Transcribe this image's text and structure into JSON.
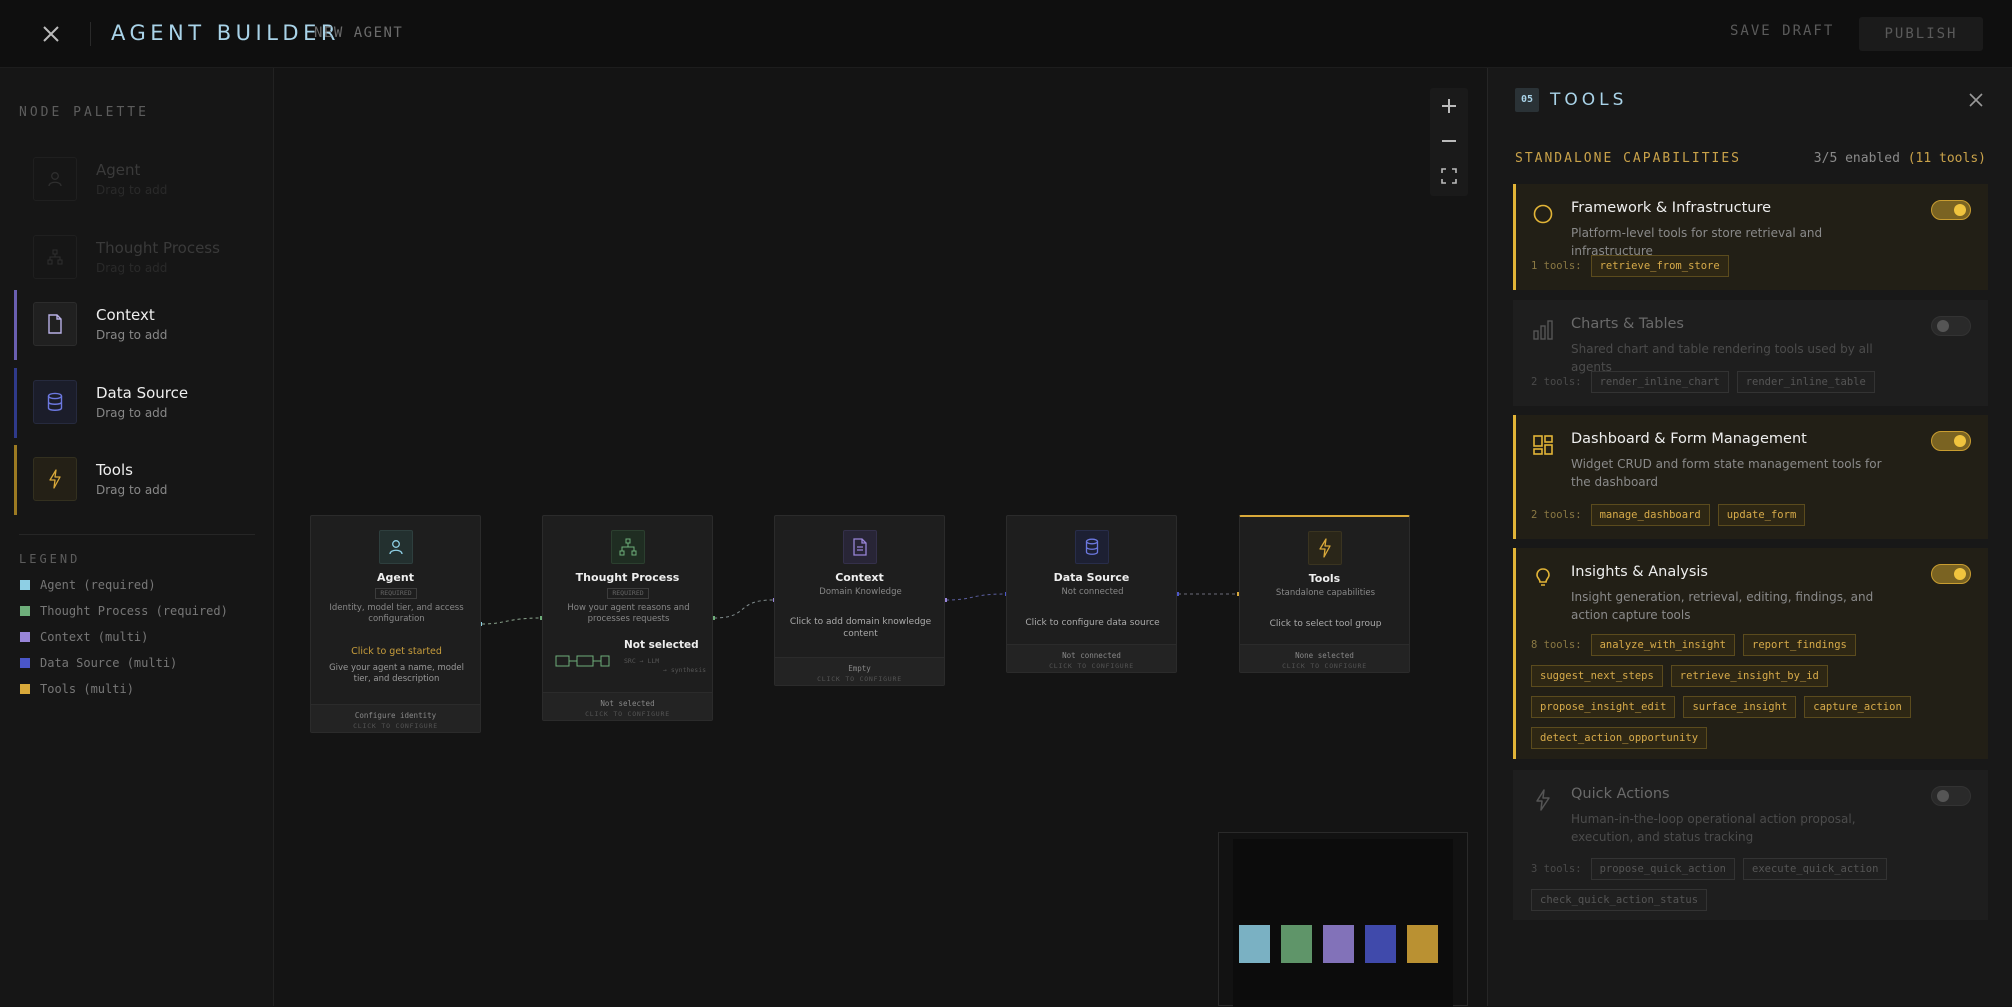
{
  "header": {
    "title": "AGENT BUILDER",
    "agent_name": "NEW AGENT",
    "save_draft": "SAVE DRAFT",
    "publish": "PUBLISH"
  },
  "palette": {
    "title": "NODE PALETTE",
    "items": [
      {
        "label": "Agent",
        "sub": "Drag to add",
        "icon": "user-icon",
        "state": "disabled"
      },
      {
        "label": "Thought Process",
        "sub": "Drag to add",
        "icon": "flow-icon",
        "state": "disabled"
      },
      {
        "label": "Context",
        "sub": "Drag to add",
        "icon": "document-icon",
        "state": "enabled"
      },
      {
        "label": "Data Source",
        "sub": "Drag to add",
        "icon": "database-icon",
        "state": "enabled"
      },
      {
        "label": "Tools",
        "sub": "Drag to add",
        "icon": "lightning-icon",
        "state": "enabled"
      }
    ],
    "legend_title": "LEGEND",
    "legend": [
      {
        "label": "Agent (required)",
        "color": "#8ecfe4"
      },
      {
        "label": "Thought Process (required)",
        "color": "#6eae7a"
      },
      {
        "label": "Context (multi)",
        "color": "#9885d8"
      },
      {
        "label": "Data Source (multi)",
        "color": "#4a56c8"
      },
      {
        "label": "Tools (multi)",
        "color": "#d9a93a"
      }
    ]
  },
  "nodes": {
    "agent": {
      "title": "Agent",
      "badge": "REQUIRED",
      "sub": "Identity, model tier, and access configuration",
      "cta": "Click to get started",
      "cta_sub": "Give your agent a name, model tier, and description",
      "foot": "Configure identity",
      "foot2": "CLICK TO CONFIGURE"
    },
    "thought": {
      "title": "Thought Process",
      "badge": "REQUIRED",
      "sub": "How your agent reasons and processes requests",
      "state": "Not selected",
      "meta1": "SRC → LLM",
      "meta2": "→ synthesis",
      "foot": "Not selected",
      "foot2": "CLICK TO CONFIGURE"
    },
    "context": {
      "title": "Context",
      "sub": "Domain Knowledge",
      "cta": "Click to add domain knowledge content",
      "foot": "Empty",
      "foot2": "CLICK TO CONFIGURE"
    },
    "datasource": {
      "title": "Data Source",
      "sub": "Not connected",
      "cta": "Click to configure data source",
      "foot": "Not connected",
      "foot2": "CLICK TO CONFIGURE"
    },
    "tools": {
      "title": "Tools",
      "sub": "Standalone capabilities",
      "cta": "Click to select tool group",
      "foot": "None selected",
      "foot2": "CLICK TO CONFIGURE"
    }
  },
  "tools_panel": {
    "num": "05",
    "title": "TOOLS",
    "section": "STANDALONE CAPABILITIES",
    "count": "3/5 enabled",
    "count_tools": "(11 tools)",
    "capabilities": [
      {
        "name": "Framework & Infrastructure",
        "desc": "Platform-level tools for store retrieval and infrastructure",
        "enabled": true,
        "icon": "circle-icon",
        "tools_label": "1 tools:",
        "tools": [
          "retrieve_from_store"
        ]
      },
      {
        "name": "Charts & Tables",
        "desc": "Shared chart and table rendering tools used by all agents",
        "enabled": false,
        "icon": "bar-chart-icon",
        "tools_label": "2 tools:",
        "tools": [
          "render_inline_chart",
          "render_inline_table"
        ]
      },
      {
        "name": "Dashboard & Form Management",
        "desc": "Widget CRUD and form state management tools for the dashboard",
        "enabled": true,
        "icon": "dashboard-icon",
        "tools_label": "2 tools:",
        "tools": [
          "manage_dashboard",
          "update_form"
        ]
      },
      {
        "name": "Insights & Analysis",
        "desc": "Insight generation, retrieval, editing, findings, and action capture tools",
        "enabled": true,
        "icon": "lightbulb-icon",
        "tools_label": "8 tools:",
        "tools": [
          "analyze_with_insight",
          "report_findings",
          "suggest_next_steps",
          "retrieve_insight_by_id",
          "propose_insight_edit",
          "surface_insight",
          "capture_action",
          "detect_action_opportunity"
        ]
      },
      {
        "name": "Quick Actions",
        "desc": "Human-in-the-loop operational action proposal, execution, and status tracking",
        "enabled": false,
        "icon": "lightning-icon",
        "tools_label": "3 tools:",
        "tools": [
          "propose_quick_action",
          "execute_quick_action",
          "check_quick_action_status"
        ]
      }
    ]
  },
  "colors": {
    "accent": "#a9d3e8",
    "gold": "#e2b437",
    "agent": "#8ecfe4",
    "thought": "#6eae7a",
    "context": "#9885d8",
    "datasource": "#4a56c8",
    "tools": "#d9a93a"
  }
}
